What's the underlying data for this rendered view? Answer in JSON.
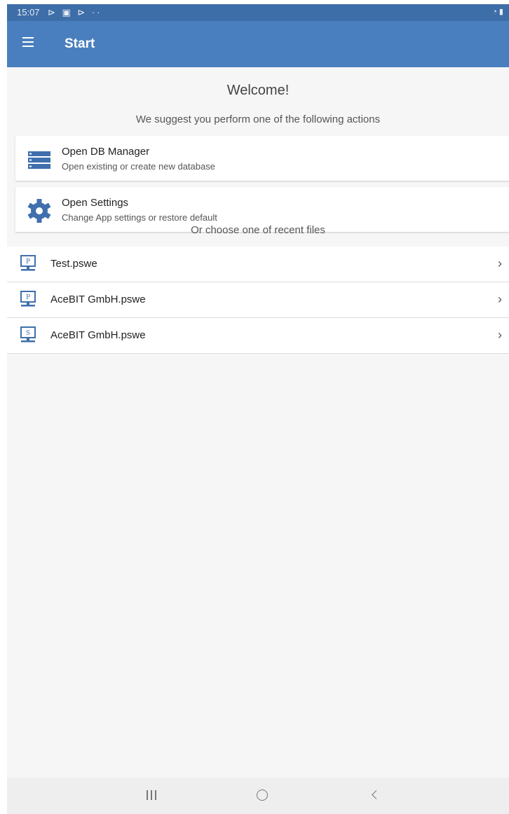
{
  "status_bar": {
    "time": "15:07",
    "notif_icons": "⊳ ▣ ⊳ ··",
    "right": "◔ ▮"
  },
  "app_bar": {
    "title": "Start"
  },
  "welcome": {
    "title": "Welcome!",
    "subtitle": "We suggest you perform one of the following actions"
  },
  "actions": [
    {
      "icon": "database-icon",
      "title": "Open DB Manager",
      "subtitle": "Open existing or create new database"
    },
    {
      "icon": "gear-icon",
      "title": "Open Settings",
      "subtitle": "Change App settings or restore default"
    }
  ],
  "recent": {
    "label": "Or choose one of recent files",
    "files": [
      {
        "badge": "P",
        "name": "Test.pswe"
      },
      {
        "badge": "P",
        "name": "AceBIT GmbH.pswe"
      },
      {
        "badge": "S",
        "name": "AceBIT GmbH.pswe"
      }
    ]
  },
  "colors": {
    "primary": "#4a7fbf",
    "status_bar": "#3e6ea8",
    "icon_blue": "#3f6fad"
  }
}
